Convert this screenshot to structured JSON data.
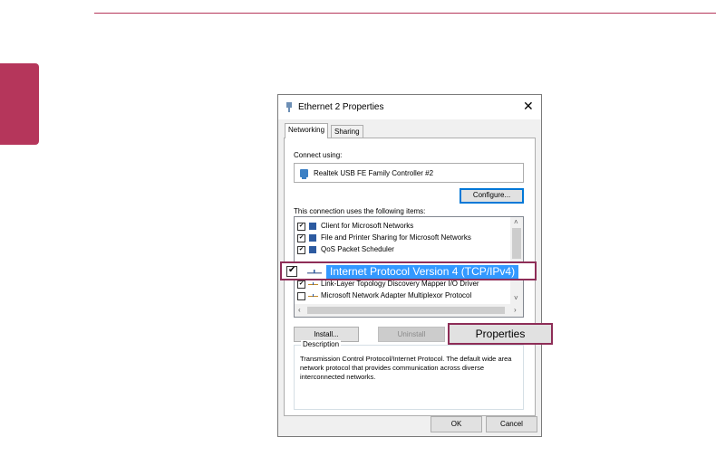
{
  "dialog": {
    "title": "Ethernet 2 Properties",
    "close": "✕",
    "tabs": [
      {
        "label": "Networking"
      },
      {
        "label": "Sharing"
      }
    ],
    "connect_using_label": "Connect using:",
    "adapter_name": "Realtek USB FE Family Controller #2",
    "configure_button": "Configure...",
    "items_label": "This connection uses the following items:",
    "items": [
      {
        "label": "Client for Microsoft Networks",
        "checked": true
      },
      {
        "label": "File and Printer Sharing for Microsoft Networks",
        "checked": true
      },
      {
        "label": "QoS Packet Scheduler",
        "checked": true
      },
      {
        "label": "Link-Layer Topology Discovery Mapper I/O Driver",
        "checked": true
      },
      {
        "label": "Microsoft Network Adapter Multiplexor Protocol",
        "checked": false
      }
    ],
    "highlighted_item": {
      "label": "Internet Protocol Version 4 (TCP/IPv4)",
      "checked": true
    },
    "install_button": "Install...",
    "uninstall_button": "Uninstall",
    "properties_button": "Properties",
    "description_label": "Description",
    "description_text": "Transmission Control Protocol/Internet Protocol. The default wide area network protocol that provides communication across diverse interconnected networks.",
    "ok_button": "OK",
    "cancel_button": "Cancel"
  },
  "colors": {
    "accent": "#b5365b",
    "callout_border": "#8e2d57",
    "selection": "#3399ff",
    "focus_border": "#0078d7"
  }
}
